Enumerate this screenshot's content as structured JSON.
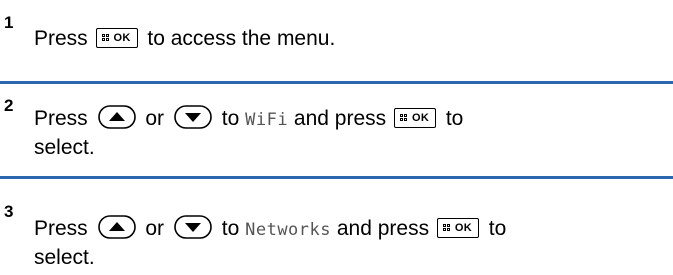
{
  "steps": [
    {
      "number": "1",
      "parts": {
        "press": "Press",
        "tail": "to access the menu."
      }
    },
    {
      "number": "2",
      "parts": {
        "press": "Press",
        "or": "or",
        "to": "to",
        "item": "WiFi",
        "and_press": "and press",
        "to2": "to",
        "select": "select."
      }
    },
    {
      "number": "3",
      "parts": {
        "press": "Press",
        "or": "or",
        "to": "to",
        "item": "Networks",
        "and_press": "and press",
        "to2": "to",
        "select": "select."
      }
    }
  ],
  "keys": {
    "ok_label": "OK",
    "ok_icon": "menu-grid-icon",
    "up_icon": "up-arrow-icon",
    "down_icon": "down-arrow-icon"
  },
  "colors": {
    "divider": "#2b66b0",
    "menu_item_text": "#555555"
  }
}
